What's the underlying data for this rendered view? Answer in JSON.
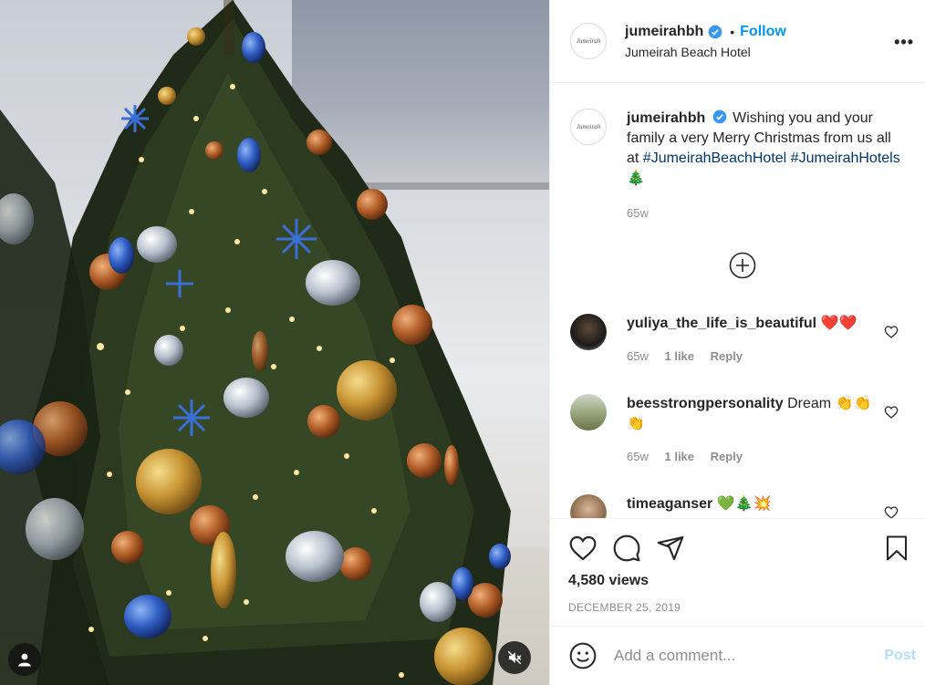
{
  "post": {
    "username": "jumeirahbh",
    "follow_label": "Follow",
    "dot": "•",
    "location": "Jumeirah Beach Hotel",
    "avatar_text": "Jumeirah",
    "caption_text": "Wishing you and your family a very Merry Christmas from us all at",
    "hashtag1": "#JumeirahBeachHotel",
    "hashtag2": "#JumeirahHotels",
    "caption_emoji": "🎄",
    "caption_time": "65w",
    "more_label": "•••",
    "views": "4,580 views",
    "date": "DECEMBER 25, 2019",
    "add_comment_placeholder": "Add a comment...",
    "post_label": "Post"
  },
  "comments": [
    {
      "username": "yuliya_the_life_is_beautiful",
      "text": "❤️❤️",
      "time": "65w",
      "likes": "1 like",
      "reply": "Reply"
    },
    {
      "username": "beesstrongpersonality",
      "text": "Dream 👏👏👏",
      "time": "65w",
      "likes": "1 like",
      "reply": "Reply"
    },
    {
      "username": "timeaganser",
      "text": "💚🎄💥",
      "time": "",
      "likes": "",
      "reply": ""
    }
  ],
  "colors": {
    "link": "#0095f6",
    "hashtag": "#00376b",
    "muted": "#8e8e8e",
    "post_disabled": "#b2dffc"
  },
  "icons": [
    "verified-icon",
    "more-icon",
    "add-circle-icon",
    "heart-icon",
    "comment-icon",
    "share-icon",
    "bookmark-icon",
    "emoji-icon",
    "user-tag-icon",
    "mute-icon"
  ]
}
